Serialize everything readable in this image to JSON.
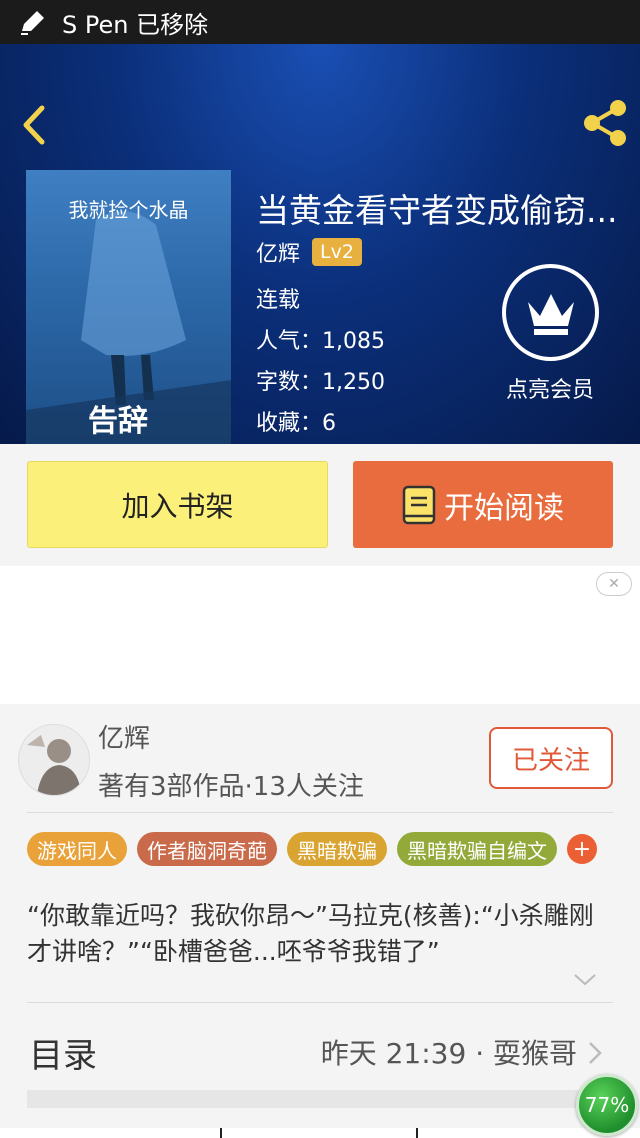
{
  "status_bar": {
    "text": "S Pen 已移除",
    "icon": "pen-icon"
  },
  "header": {
    "back_icon": "chevron-left-icon",
    "share_icon": "share-icon",
    "accent_color": "#f2d24a"
  },
  "book": {
    "cover_subtitle": "我就捡个水晶",
    "cover_title": "告辞",
    "title": "当黄金看守者变成偷窃...",
    "author": "亿辉",
    "level": "Lv2",
    "status": "连载",
    "popularity": "人气：1,085",
    "word_count": "字数：1,250",
    "favorites": "收藏：6"
  },
  "vip": {
    "icon": "crown-icon",
    "label": "点亮会员"
  },
  "actions": {
    "add_to_shelf": "加入书架",
    "start_reading": "开始阅读",
    "read_icon": "book-icon"
  },
  "ad": {
    "close_icon": "close-icon"
  },
  "author_card": {
    "name": "亿辉",
    "stats": "著有3部作品·13人关注",
    "follow_label": "已关注",
    "tags": [
      {
        "label": "游戏同人",
        "color": "#e9a23a"
      },
      {
        "label": "作者脑洞奇葩",
        "color": "#c96a4a"
      },
      {
        "label": "黑暗欺骗",
        "color": "#d9a431"
      },
      {
        "label": "黑暗欺骗自编文",
        "color": "#93aa3a"
      }
    ],
    "more_tags": "+",
    "intro": "“你敢靠近吗？我砍你昂～”马拉克(核善):“小杀雕刚才讲啥？”“卧槽爸爸...呸爷爷我错了”"
  },
  "toc": {
    "title": "目录",
    "last_update": "昨天 21:39 · 耍猴哥"
  },
  "float_badge": {
    "value": "77%"
  }
}
